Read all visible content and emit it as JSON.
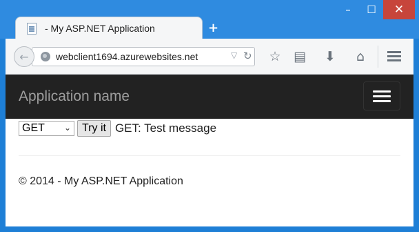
{
  "browser": {
    "tab_title": "- My ASP.NET Application",
    "new_tab_label": "+",
    "url": "webclient1694.azurewebsites.net",
    "window_controls": {
      "minimize": "–",
      "maximize": "☐",
      "close": "✕"
    },
    "icons": {
      "back": "back-arrow-icon",
      "site": "globe-icon",
      "bookmark": "star-icon",
      "reading_list": "reading-list-icon",
      "downloads": "download-icon",
      "home": "home-icon",
      "menu": "hamburger-menu-icon"
    }
  },
  "page": {
    "navbar": {
      "brand": "Application name",
      "background": "#222222"
    },
    "form": {
      "method_selected": "GET",
      "try_button_label": "Try it",
      "result_text": "GET: Test message"
    },
    "footer": {
      "copyright": "© 2014 - My ASP.NET Application"
    }
  },
  "colors": {
    "window_frame": "#2f8be0",
    "close_button": "#c7453b",
    "toolbar": "#f5f6f7",
    "brand_text": "#9d9d9d"
  }
}
